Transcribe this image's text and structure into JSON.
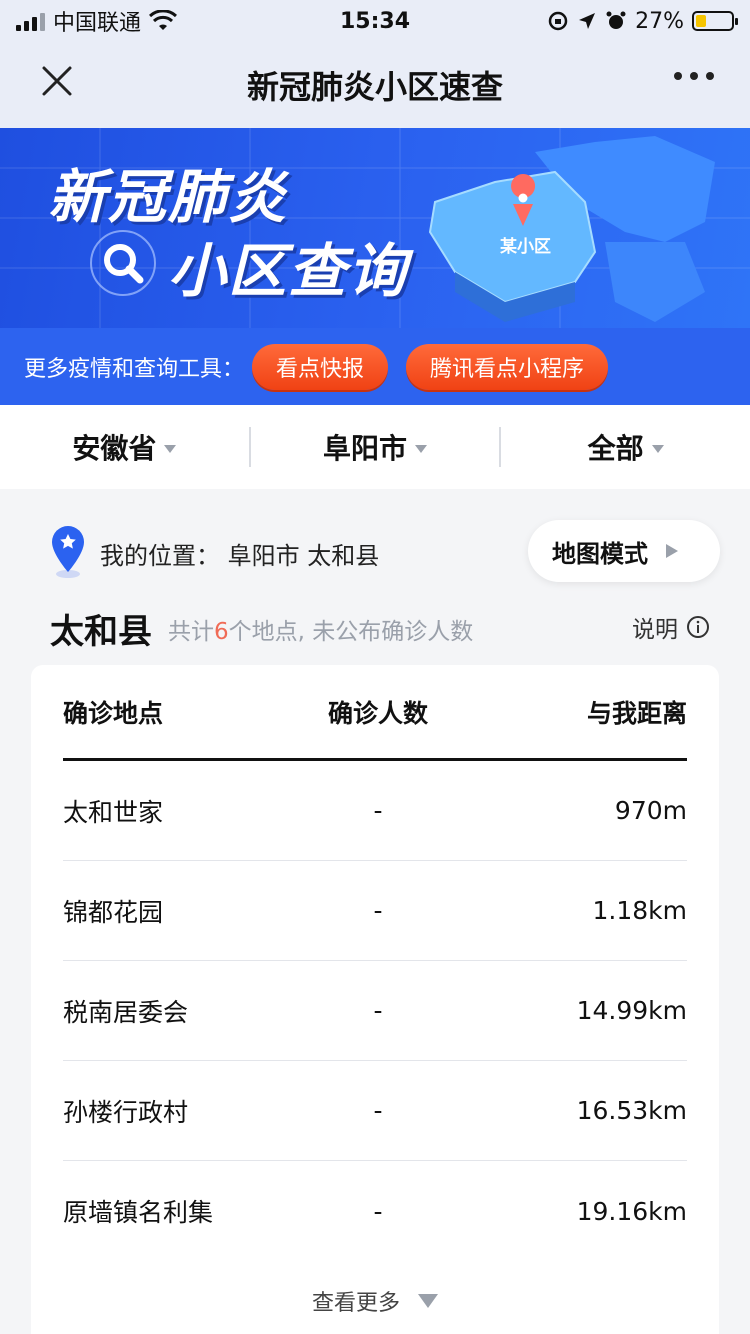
{
  "status_bar": {
    "carrier": "中国联通",
    "time": "15:34",
    "battery": "27%"
  },
  "nav": {
    "title": "新冠肺炎小区速查"
  },
  "banner": {
    "line1": "新冠肺炎",
    "line2": "小区查询",
    "map_label": "某小区"
  },
  "tools": {
    "label": "更多疫情和查询工具：",
    "buttons": [
      "看点快报",
      "腾讯看点小程序"
    ]
  },
  "filters": [
    "安徽省",
    "阜阳市",
    "全部"
  ],
  "location": {
    "text": "我的位置： 阜阳市 太和县",
    "map_mode": "地图模式"
  },
  "county": {
    "name": "太和县",
    "summary_prefix": "共计",
    "count": "6",
    "summary_suffix": "个地点, 未公布确诊人数",
    "explain": "说明"
  },
  "table": {
    "headers": [
      "确诊地点",
      "确诊人数",
      "与我距离"
    ],
    "rows": [
      {
        "place": "太和世家",
        "cases": "-",
        "distance": "970m"
      },
      {
        "place": "锦都花园",
        "cases": "-",
        "distance": "1.18km"
      },
      {
        "place": "税南居委会",
        "cases": "-",
        "distance": "14.99km"
      },
      {
        "place": "孙楼行政村",
        "cases": "-",
        "distance": "16.53km"
      },
      {
        "place": "原墙镇名利集",
        "cases": "-",
        "distance": "19.16km"
      }
    ],
    "more": "查看更多"
  },
  "colors": {
    "brand_blue": "#2b62f0",
    "accent_orange": "#f04214",
    "highlight_red": "#f06b56"
  }
}
